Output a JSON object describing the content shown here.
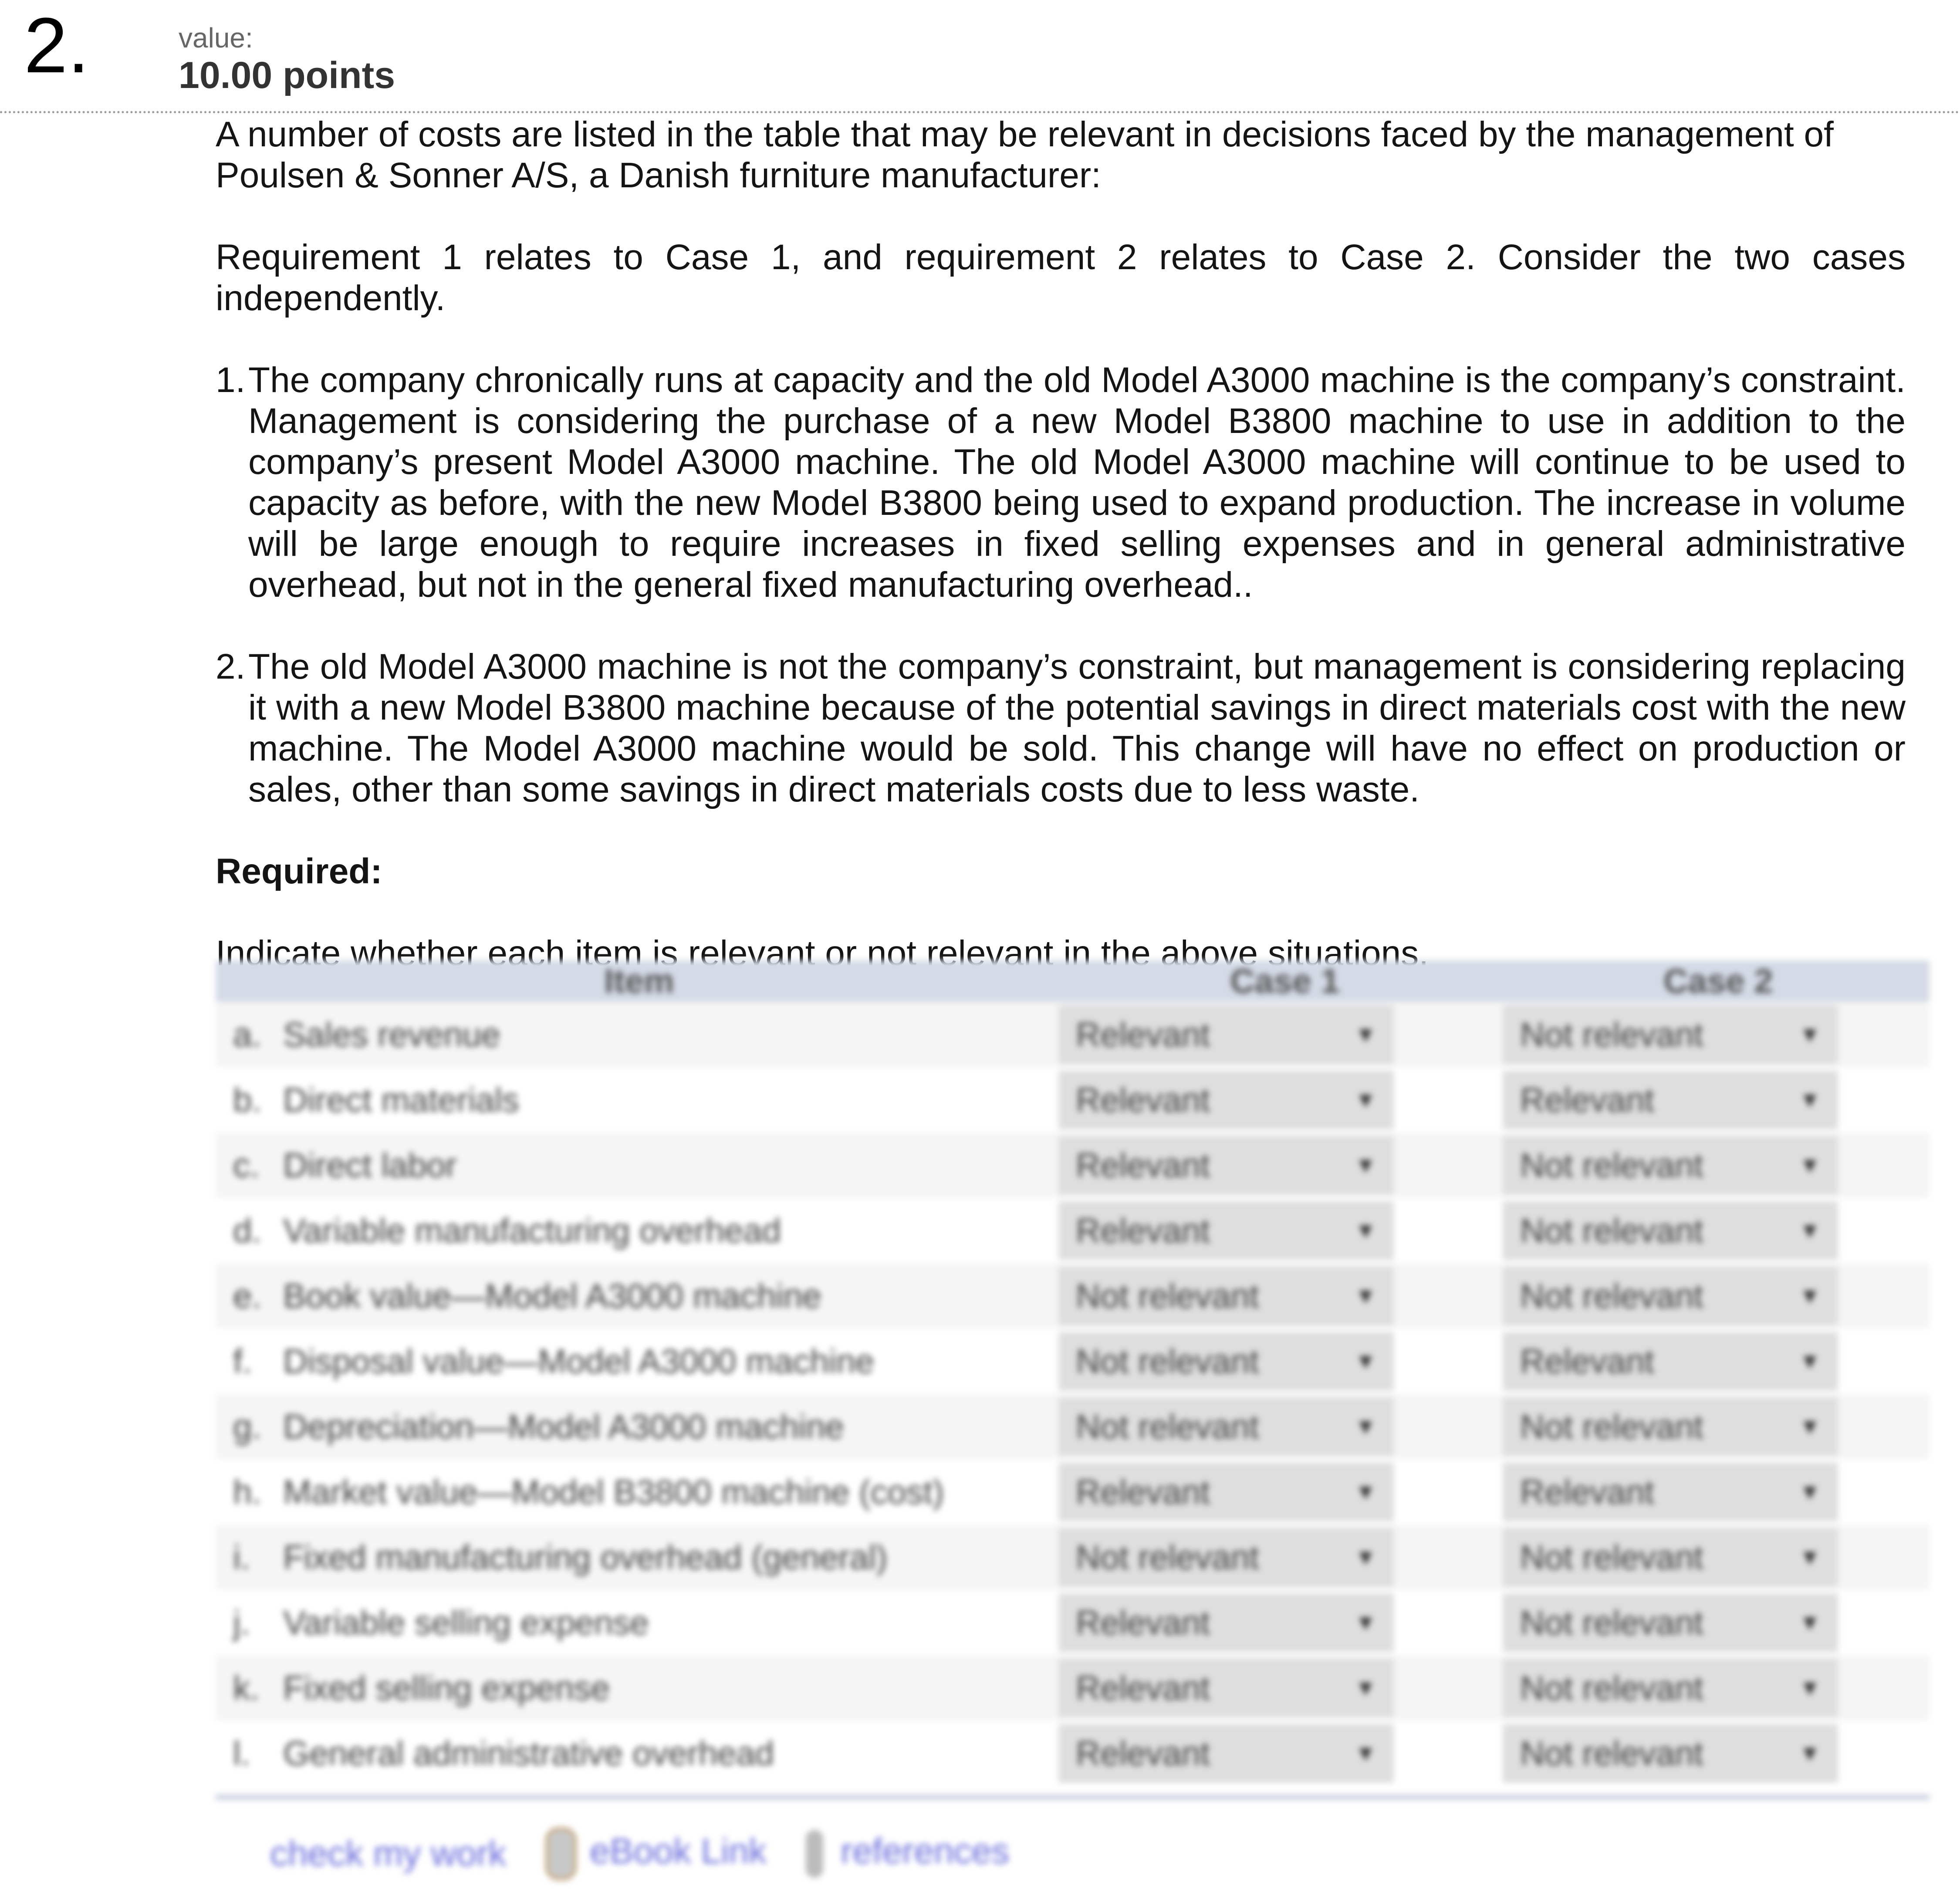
{
  "question": {
    "number": "2.",
    "value_label": "value:",
    "points": "10.00 points"
  },
  "intro": {
    "paragraph1": "A number of costs are listed in the table that may be relevant in decisions faced by the management of Poulsen & Sonner A/S, a Danish furniture manufacturer:",
    "paragraph2": "Requirement 1 relates to Case 1, and requirement 2 relates to Case 2. Consider the two cases independently."
  },
  "cases": [
    {
      "num": "1.",
      "text": "The company chronically runs at capacity and the old Model A3000 machine is the company’s constraint. Management is considering the purchase of a new Model B3800 machine to use in addition to the company’s present Model A3000 machine. The old Model A3000 machine will continue to be used to capacity as before, with the new Model B3800 being used to expand production. The increase in volume will be large enough to require increases in fixed selling expenses and in general administrative overhead, but not in the general fixed manufacturing overhead.."
    },
    {
      "num": "2.",
      "text": "The old Model A3000 machine is not the company’s constraint, but management is considering replacing it with a new Model B3800 machine because of the potential savings in direct materials cost with the new machine. The Model A3000 machine would be sold. This change will have no effect on production or sales, other than some savings in direct materials costs due to less waste."
    }
  ],
  "required": {
    "heading": "Required:",
    "instruction": "Indicate whether each item is relevant or not relevant in the above situations."
  },
  "table": {
    "headers": {
      "item": "Item",
      "case1": "Case 1",
      "case2": "Case 2"
    },
    "rows": [
      {
        "letter": "a.",
        "item": "Sales revenue",
        "case1": "Relevant",
        "case2": "Not relevant"
      },
      {
        "letter": "b.",
        "item": "Direct materials",
        "case1": "Relevant",
        "case2": "Relevant"
      },
      {
        "letter": "c.",
        "item": "Direct labor",
        "case1": "Relevant",
        "case2": "Not relevant"
      },
      {
        "letter": "d.",
        "item": "Variable manufacturing overhead",
        "case1": "Relevant",
        "case2": "Not relevant"
      },
      {
        "letter": "e.",
        "item": "Book value—Model A3000 machine",
        "case1": "Not relevant",
        "case2": "Not relevant"
      },
      {
        "letter": "f.",
        "item": "Disposal value—Model A3000 machine",
        "case1": "Not relevant",
        "case2": "Relevant"
      },
      {
        "letter": "g.",
        "item": "Depreciation—Model A3000 machine",
        "case1": "Not relevant",
        "case2": "Not relevant"
      },
      {
        "letter": "h.",
        "item": "Market value—Model B3800 machine (cost)",
        "case1": "Relevant",
        "case2": "Relevant"
      },
      {
        "letter": "i.",
        "item": "Fixed manufacturing overhead (general)",
        "case1": "Not relevant",
        "case2": "Not relevant"
      },
      {
        "letter": "j.",
        "item": "Variable selling expense",
        "case1": "Relevant",
        "case2": "Not relevant"
      },
      {
        "letter": "k.",
        "item": "Fixed selling expense",
        "case1": "Relevant",
        "case2": "Not relevant"
      },
      {
        "letter": "l.",
        "item": "General administrative overhead",
        "case1": "Relevant",
        "case2": "Not relevant"
      }
    ],
    "dropdown_arrow": "▼"
  },
  "footer_links": {
    "check": "check my work",
    "ebook_icon": "ebook-icon",
    "ebook": "eBook Link",
    "references_icon": "references-icon",
    "references": "references"
  },
  "colors": {
    "header_bg": "#d5dae6",
    "select_bg": "#dedede",
    "link": "#6b6bdc"
  }
}
